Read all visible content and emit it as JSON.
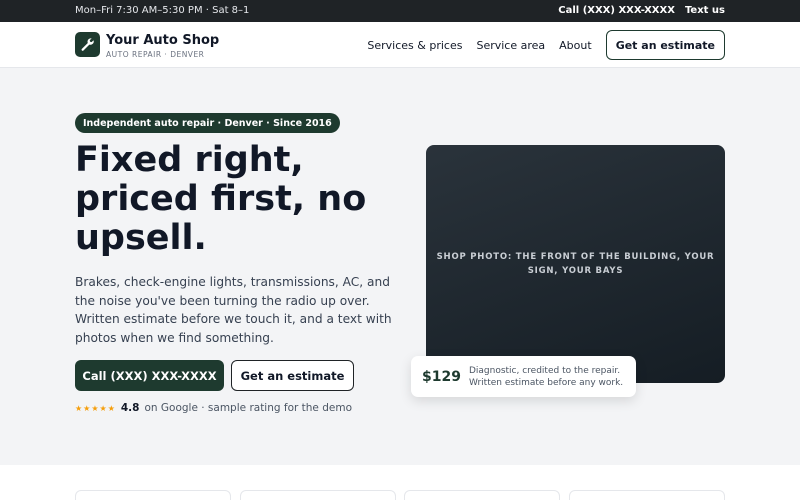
{
  "topbar": {
    "hours": "Mon–Fri 7:30 AM–5:30 PM · Sat 8–1",
    "call": "Call (XXX) XXX-XXXX",
    "text": "Text us"
  },
  "brand": {
    "name": "Your Auto Shop",
    "tagline": "AUTO REPAIR · DENVER",
    "logo_icon": "wrench-icon"
  },
  "nav": {
    "items": [
      "Services & prices",
      "Service area",
      "About"
    ],
    "cta": "Get an estimate"
  },
  "hero": {
    "badge": "Independent auto repair · Denver · Since 2016",
    "headline": "Fixed right, priced first, no upsell.",
    "lead": "Brakes, check-engine lights, transmissions, AC, and the noise you've been turning the radio up over. Written estimate before we touch it, and a text with photos when we find something.",
    "primary_button": "Call (XXX) XXX-XXXX",
    "secondary_button": "Get an estimate",
    "rating": {
      "stars": "★★★★★",
      "score": "4.8",
      "text": "on Google · sample rating for the demo"
    },
    "photo_placeholder": "Shop photo: the front of the building, your sign, your bays",
    "price_card": {
      "price": "$129",
      "desc_line1": "Diagnostic, credited to the repair.",
      "desc_line2": "Written estimate before any work."
    }
  },
  "colors": {
    "brand_green": "#1e3a2f",
    "topbar_bg": "#1f2326",
    "star": "#f59e0b",
    "page_bg": "#f3f4f6"
  }
}
